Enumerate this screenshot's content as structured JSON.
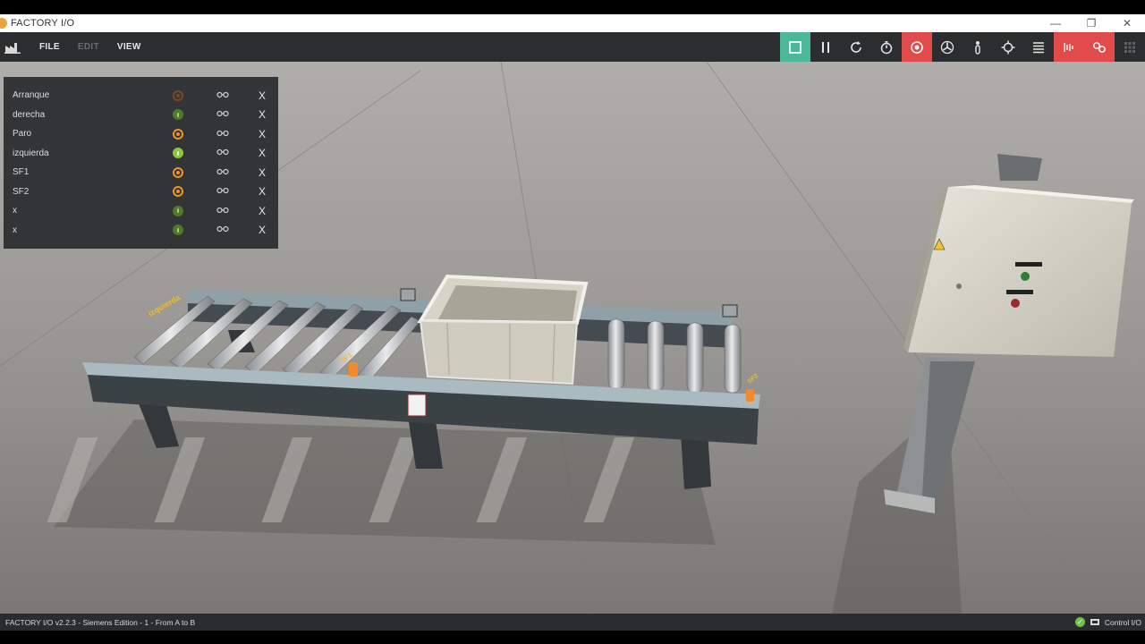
{
  "window": {
    "title": "FACTORY I/O",
    "controls": [
      "—",
      "❐",
      "✕"
    ]
  },
  "menu": {
    "items": [
      {
        "label": "FILE",
        "enabled": true
      },
      {
        "label": "EDIT",
        "enabled": false
      },
      {
        "label": "VIEW",
        "enabled": true
      }
    ]
  },
  "toolbar": {
    "tools": [
      {
        "icon": "stop-icon",
        "state": "active-green"
      },
      {
        "icon": "pause-icon",
        "state": "normal"
      },
      {
        "icon": "reset-icon",
        "state": "normal"
      },
      {
        "icon": "timer-icon",
        "state": "normal"
      },
      {
        "icon": "camera-orbit-icon",
        "state": "active-red"
      },
      {
        "icon": "fan-icon",
        "state": "normal"
      },
      {
        "icon": "first-person-icon",
        "state": "normal"
      },
      {
        "icon": "crosshair-icon",
        "state": "normal"
      },
      {
        "icon": "list-icon",
        "state": "normal"
      },
      {
        "icon": "sensor-icon",
        "state": "active-red"
      },
      {
        "icon": "link-icon",
        "state": "active-red"
      },
      {
        "icon": "grid-icon",
        "state": "dim"
      }
    ]
  },
  "tags": [
    {
      "name": "Arranque",
      "state": "orange-dim"
    },
    {
      "name": "derecha",
      "state": "green-dim"
    },
    {
      "name": "Paro",
      "state": "orange"
    },
    {
      "name": "izquierda",
      "state": "green"
    },
    {
      "name": "SF1",
      "state": "orange"
    },
    {
      "name": "SF2",
      "state": "orange"
    },
    {
      "name": "x",
      "state": "green-dim"
    },
    {
      "name": "x",
      "state": "green-dim"
    }
  ],
  "tag_force_icon": "force-icon",
  "tag_remove_label": "X",
  "scene": {
    "conveyor_label_left": "izquierda",
    "conveyor_label_sensor": "SF1",
    "conveyor_label_right": "SF2"
  },
  "status": {
    "left": "FACTORY I/O v2.2.3 - Siemens Edition - 1 - From A to B",
    "right": "Control I/O"
  },
  "colors": {
    "accent_green": "#4cb89a",
    "accent_red": "#e24b4b",
    "tag_orange": "#f0932b",
    "tag_green": "#8cc63f"
  }
}
